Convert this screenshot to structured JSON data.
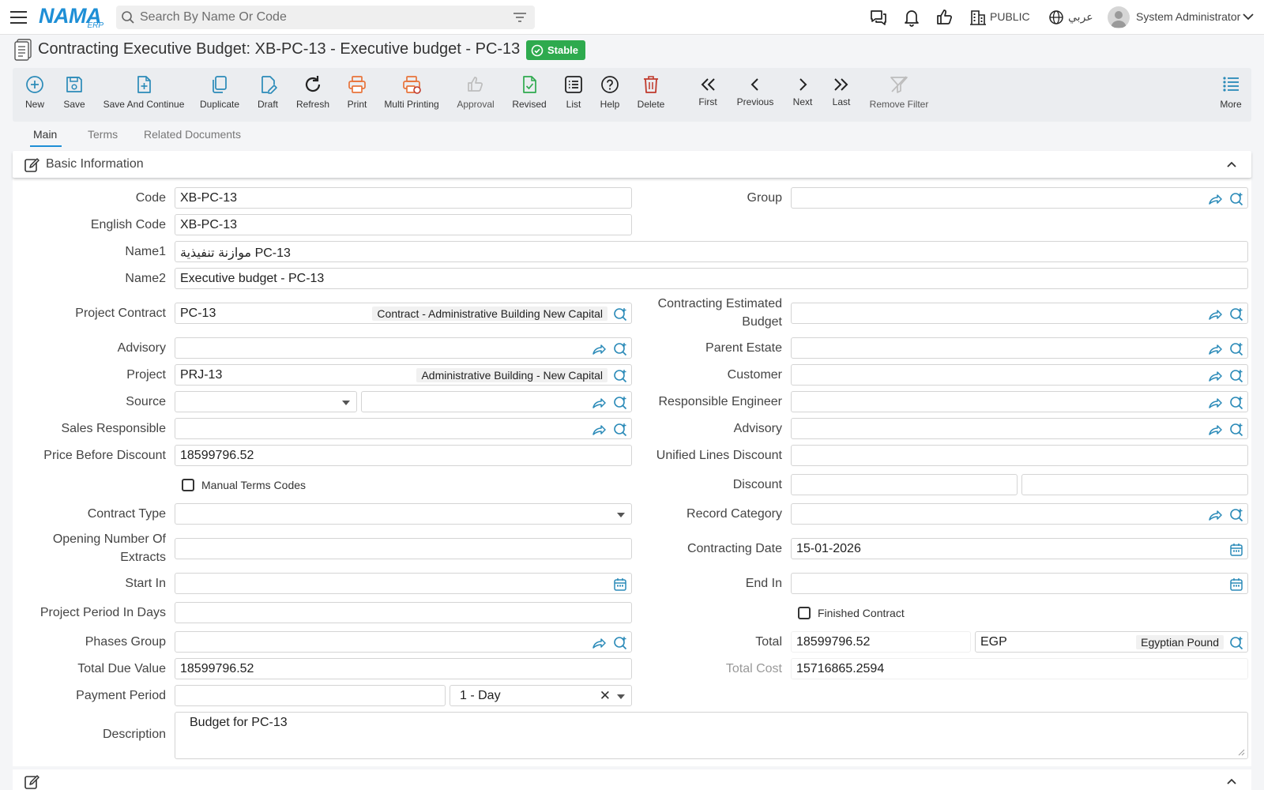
{
  "topbar": {
    "logo_main": "NAMA",
    "logo_sub": "ERP",
    "search_placeholder": "Search By Name Or Code",
    "branch": "PUBLIC",
    "language": "عربي",
    "user": "System Administrator"
  },
  "page": {
    "title": "Contracting Executive Budget: XB-PC-13 - Executive budget - PC-13",
    "status": "Stable"
  },
  "toolbar": {
    "new": "New",
    "save": "Save",
    "save_continue": "Save And Continue",
    "duplicate": "Duplicate",
    "draft": "Draft",
    "refresh": "Refresh",
    "print": "Print",
    "multi_printing": "Multi Printing",
    "approval": "Approval",
    "revised": "Revised",
    "list": "List",
    "help": "Help",
    "delete": "Delete",
    "first": "First",
    "previous": "Previous",
    "next": "Next",
    "last": "Last",
    "remove_filter": "Remove Filter",
    "more": "More"
  },
  "tabs": {
    "main": "Main",
    "terms": "Terms",
    "related": "Related Documents"
  },
  "section": {
    "title": "Basic Information"
  },
  "form": {
    "code": {
      "label": "Code",
      "value": "XB-PC-13"
    },
    "english_code": {
      "label": "English Code",
      "value": "XB-PC-13"
    },
    "name1": {
      "label": "Name1",
      "value": "موازنة تنفيذية PC-13"
    },
    "name2": {
      "label": "Name2",
      "value": "Executive budget - PC-13"
    },
    "project_contract": {
      "label": "Project Contract",
      "value": "PC-13",
      "ref": "Contract - Administrative Building New Capital"
    },
    "advisory": {
      "label": "Advisory",
      "value": ""
    },
    "project": {
      "label": "Project",
      "value": "PRJ-13",
      "ref": "Administrative Building - New Capital"
    },
    "source": {
      "label": "Source",
      "value": ""
    },
    "sales_responsible": {
      "label": "Sales Responsible",
      "value": ""
    },
    "price_before_discount": {
      "label": "Price Before Discount",
      "value": "18599796.52"
    },
    "manual_terms_codes": {
      "label": "Manual Terms Codes"
    },
    "contract_type": {
      "label": "Contract Type",
      "value": ""
    },
    "opening_number_1": "Opening Number Of",
    "opening_number_2": "Extracts",
    "start_in": {
      "label": "Start In",
      "value": ""
    },
    "project_period": {
      "label": "Project Period In Days",
      "value": ""
    },
    "phases_group": {
      "label": "Phases Group",
      "value": ""
    },
    "total_due_value": {
      "label": "Total Due Value",
      "value": "18599796.52"
    },
    "payment_period": {
      "label": "Payment Period",
      "value": "",
      "unit": "1 - Day"
    },
    "description": {
      "label": "Description",
      "value": "Budget for PC-13"
    },
    "group": {
      "label": "Group",
      "value": ""
    },
    "contracting_estimated_1": "Contracting Estimated",
    "contracting_estimated_2": "Budget",
    "parent_estate": {
      "label": "Parent Estate",
      "value": ""
    },
    "customer": {
      "label": "Customer",
      "value": ""
    },
    "responsible_engineer": {
      "label": "Responsible Engineer",
      "value": ""
    },
    "advisory2": {
      "label": "Advisory",
      "value": ""
    },
    "unified_lines_discount": {
      "label": "Unified Lines Discount",
      "value": ""
    },
    "discount": {
      "label": "Discount",
      "value": ""
    },
    "record_category": {
      "label": "Record Category",
      "value": ""
    },
    "contracting_date": {
      "label": "Contracting Date",
      "value": "15-01-2026"
    },
    "end_in": {
      "label": "End In",
      "value": ""
    },
    "finished_contract": {
      "label": "Finished Contract"
    },
    "total": {
      "label": "Total",
      "value": "18599796.52",
      "currency": "EGP",
      "currency_name": "Egyptian Pound"
    },
    "total_cost": {
      "label": "Total Cost",
      "value": "15716865.2594"
    }
  },
  "colors": {
    "accent": "#1e8fd6",
    "status": "#2eaa4e",
    "print": "#e8733a",
    "delete": "#c0392b",
    "icon": "#2a8ab8"
  }
}
